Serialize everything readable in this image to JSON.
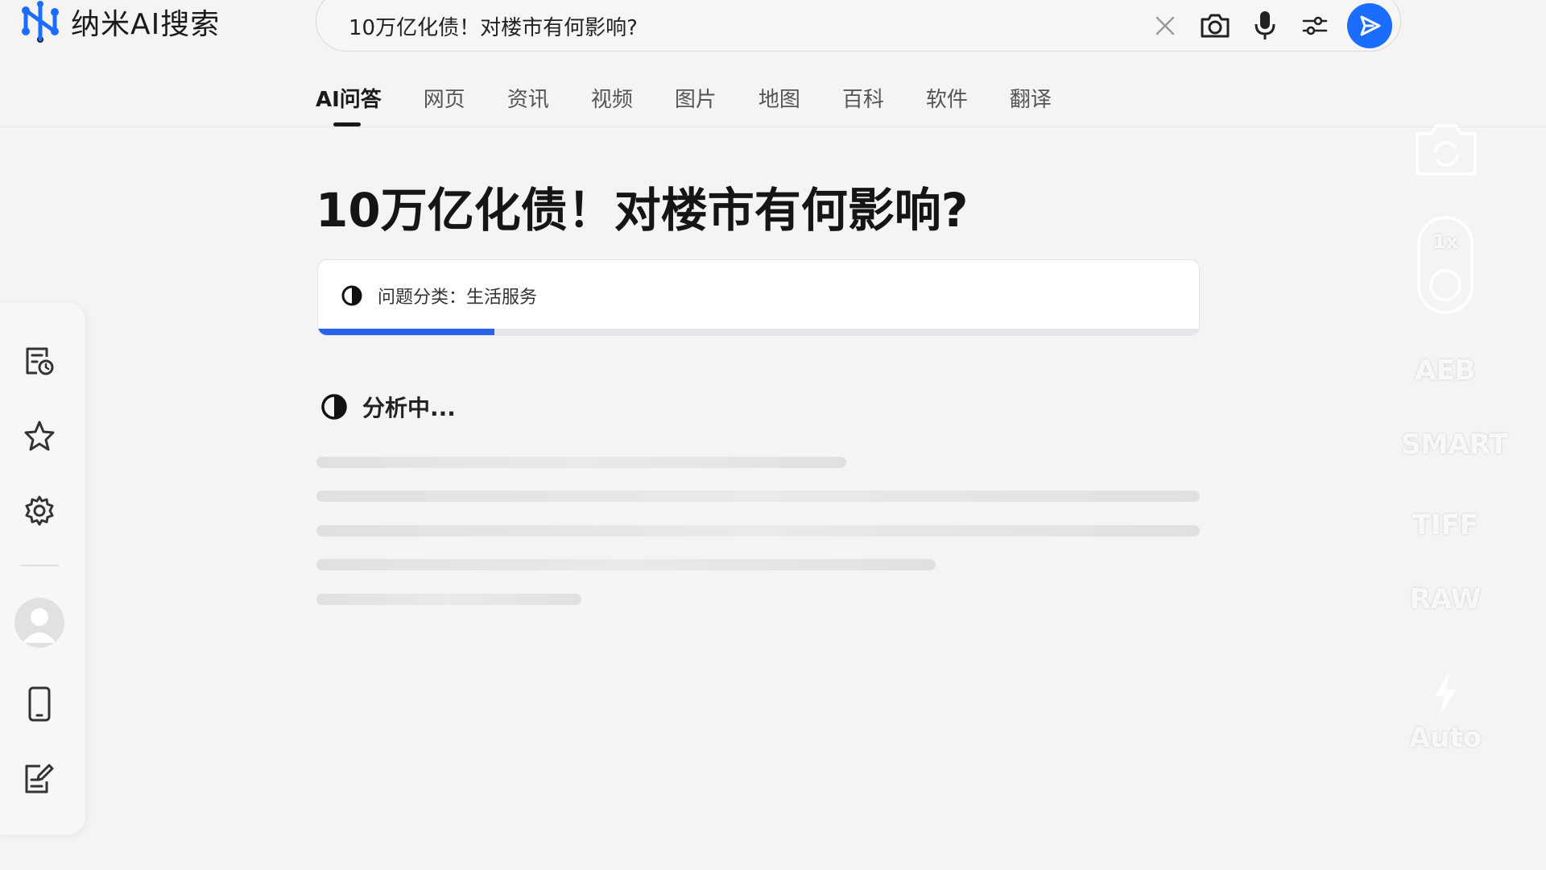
{
  "app": {
    "logo_text": "纳米AI搜索",
    "brand_color": "#1a6dff"
  },
  "search": {
    "query": "10万亿化债！对楼市有何影响?",
    "icons": [
      "close-icon",
      "camera-icon",
      "microphone-icon",
      "filter-sliders-icon",
      "send-icon"
    ]
  },
  "tabs": [
    {
      "label": "AI问答",
      "active": true
    },
    {
      "label": "网页",
      "active": false
    },
    {
      "label": "资讯",
      "active": false
    },
    {
      "label": "视频",
      "active": false
    },
    {
      "label": "图片",
      "active": false
    },
    {
      "label": "地图",
      "active": false
    },
    {
      "label": "百科",
      "active": false
    },
    {
      "label": "软件",
      "active": false
    },
    {
      "label": "翻译",
      "active": false
    }
  ],
  "sidebar": {
    "items": [
      "history-icon",
      "star-icon",
      "gear-icon",
      "avatar",
      "phone-icon",
      "note-edit-icon"
    ]
  },
  "main": {
    "title": "10万亿化债！对楼市有何影响?",
    "category_text": "问题分类：生活服务",
    "progress": 0.2,
    "analyzing_text": "分析中..."
  },
  "camera_hud": {
    "zoom": "1x",
    "labels": [
      "AEB",
      "SMART",
      "TIFF",
      "RAW"
    ],
    "flash": "Auto"
  }
}
